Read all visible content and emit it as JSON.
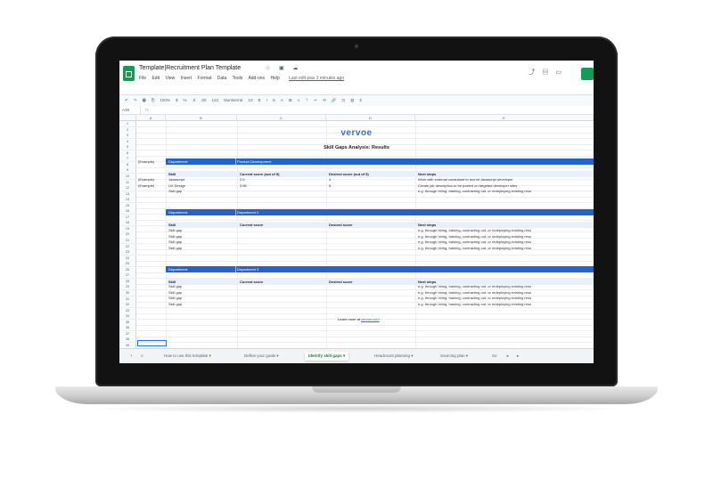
{
  "doc": {
    "title": "Template|Recruitment Plan Template",
    "title_icons": "☆ ▣ ☁",
    "menu": [
      "File",
      "Edit",
      "View",
      "Insert",
      "Format",
      "Data",
      "Tools",
      "Add-ons",
      "Help"
    ],
    "last_edit": "Last edit was 3 minutes ago"
  },
  "toolbar": {
    "items": [
      "↶",
      "↷",
      "🖶",
      "⎘",
      "100%",
      "$",
      "%",
      ".0",
      ".00",
      "123",
      "Montserrat",
      "10",
      "B",
      "I",
      "S",
      "A",
      "⊞",
      "≡",
      "⊤",
      "↵",
      "⟲",
      "🔗",
      "⊡",
      "▥",
      "Σ"
    ]
  },
  "formula_bar": {
    "ref": "A39",
    "fx": "fx"
  },
  "columns": [
    "A",
    "B",
    "C",
    "D",
    "E"
  ],
  "rows": [
    1,
    2,
    3,
    4,
    5,
    6,
    7,
    8,
    9,
    10,
    11,
    12,
    13,
    14,
    15,
    16,
    17,
    18,
    19,
    20,
    21,
    22,
    23,
    24,
    25,
    26,
    27,
    28,
    29,
    30,
    31,
    32,
    33,
    34,
    35,
    36,
    37,
    38,
    39
  ],
  "brand": "vervoe",
  "sheet_title": "Skill Gaps Analysis: Results",
  "example_label": "(Example)",
  "dept1": {
    "label": "Department:",
    "value": "Product Development"
  },
  "dept2": {
    "label": "Department:",
    "value": "Department 2"
  },
  "dept3": {
    "label": "Department:",
    "value": "Department 3"
  },
  "headers1": {
    "skill": "Skill",
    "current": "Current score (out of 5)",
    "desired": "Desired score (out of 5)",
    "next": "Next steps"
  },
  "headers": {
    "skill": "Skill",
    "current": "Current score",
    "desired": "Desired score",
    "next": "Next steps"
  },
  "example_rows": [
    {
      "tag": "(Example)",
      "skill": "Javascript",
      "current": "2.5",
      "desired": "4",
      "next": "Work with external consultant to recruit Javascript developer"
    },
    {
      "tag": "(Example)",
      "skill": "UX Design",
      "current": "3.85",
      "desired": "5",
      "next": "Create job description to be posted on targeted developer sites"
    }
  ],
  "skillgap": "Skill gap",
  "next_placeholder": "e.g. through hiring, training, contracting out, or redeploying existing reso",
  "learn": {
    "text": "Learn more at",
    "link": "vervoe.com"
  },
  "tabs": [
    {
      "label": "How to use this template ▾"
    },
    {
      "label": "Define your goals ▾"
    },
    {
      "label": "Identify skill gaps ▾",
      "active": true
    },
    {
      "label": "Headcount planning ▾"
    },
    {
      "label": "Sourcing plan ▾"
    },
    {
      "label": "So"
    }
  ],
  "colors": {
    "brand_blue": "#2f6fd6",
    "band_blue": "#2563c7",
    "sheets_green": "#0f9d58"
  }
}
